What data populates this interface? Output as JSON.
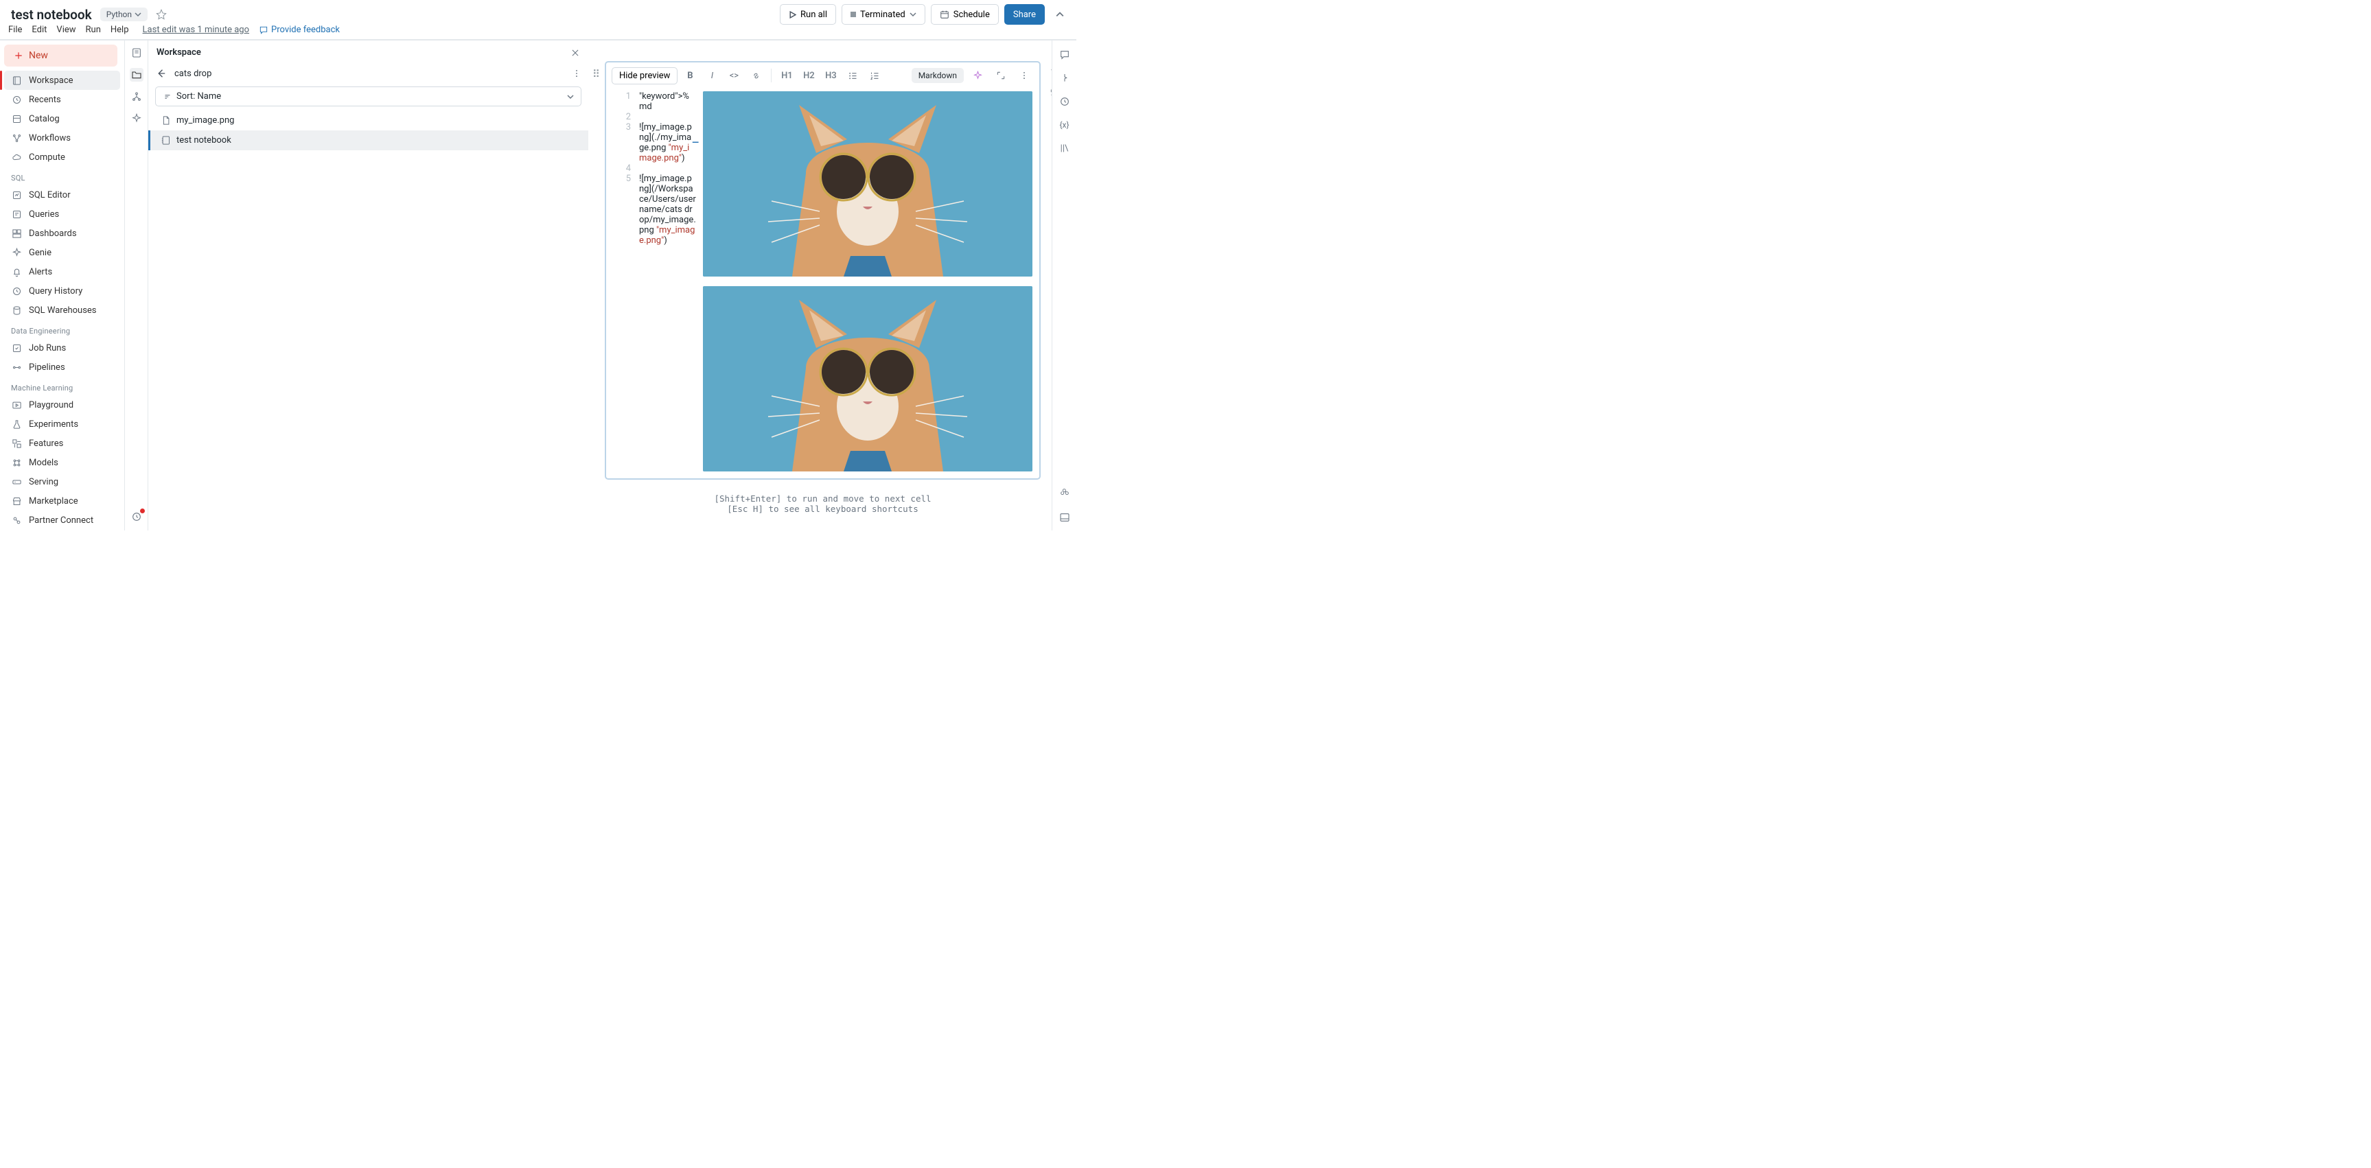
{
  "header": {
    "title": "test notebook",
    "language": "Python",
    "menubar": [
      "File",
      "Edit",
      "View",
      "Run",
      "Help"
    ],
    "last_edit": "Last edit was 1 minute ago",
    "feedback": "Provide feedback",
    "run_all": "Run all",
    "compute_state": "Terminated",
    "schedule": "Schedule",
    "share": "Share"
  },
  "leftnav": {
    "new": "New",
    "top": [
      {
        "label": "Workspace",
        "icon": "folder-tree"
      },
      {
        "label": "Recents",
        "icon": "clock"
      },
      {
        "label": "Catalog",
        "icon": "catalog"
      },
      {
        "label": "Workflows",
        "icon": "workflow"
      },
      {
        "label": "Compute",
        "icon": "cloud"
      }
    ],
    "sections": [
      {
        "title": "SQL",
        "items": [
          {
            "label": "SQL Editor",
            "icon": "sql"
          },
          {
            "label": "Queries",
            "icon": "query"
          },
          {
            "label": "Dashboards",
            "icon": "dashboard"
          },
          {
            "label": "Genie",
            "icon": "sparkle"
          },
          {
            "label": "Alerts",
            "icon": "bell"
          },
          {
            "label": "Query History",
            "icon": "history"
          },
          {
            "label": "SQL Warehouses",
            "icon": "warehouse"
          }
        ]
      },
      {
        "title": "Data Engineering",
        "items": [
          {
            "label": "Job Runs",
            "icon": "job"
          },
          {
            "label": "Pipelines",
            "icon": "pipeline"
          }
        ]
      },
      {
        "title": "Machine Learning",
        "items": [
          {
            "label": "Playground",
            "icon": "play"
          },
          {
            "label": "Experiments",
            "icon": "flask"
          },
          {
            "label": "Features",
            "icon": "features"
          },
          {
            "label": "Models",
            "icon": "model"
          },
          {
            "label": "Serving",
            "icon": "serving"
          }
        ]
      }
    ],
    "bottom": [
      {
        "label": "Marketplace",
        "icon": "store"
      },
      {
        "label": "Partner Connect",
        "icon": "partner"
      }
    ]
  },
  "browser": {
    "title": "Workspace",
    "path": "cats drop",
    "sort": "Sort: Name",
    "files": [
      {
        "name": "my_image.png",
        "icon": "file",
        "selected": false
      },
      {
        "name": "test notebook",
        "icon": "notebook",
        "selected": true
      }
    ]
  },
  "cell": {
    "hide_preview": "Hide preview",
    "cell_type": "Markdown",
    "lines": [
      {
        "n": "1",
        "t": "%md"
      },
      {
        "n": "2",
        "t": ""
      },
      {
        "n": "3",
        "t": "![my_image.png](./my_image.png \"my_image.png\")"
      },
      {
        "n": "4",
        "t": ""
      },
      {
        "n": "5",
        "t": "![my_image.png](/Workspace/Users/username/cats drop/my_image.png \"my_image.png\")"
      }
    ]
  },
  "hints": {
    "l1": "[Shift+Enter] to run and move to next cell",
    "l2": "[Esc H] to see all keyboard shortcuts"
  }
}
